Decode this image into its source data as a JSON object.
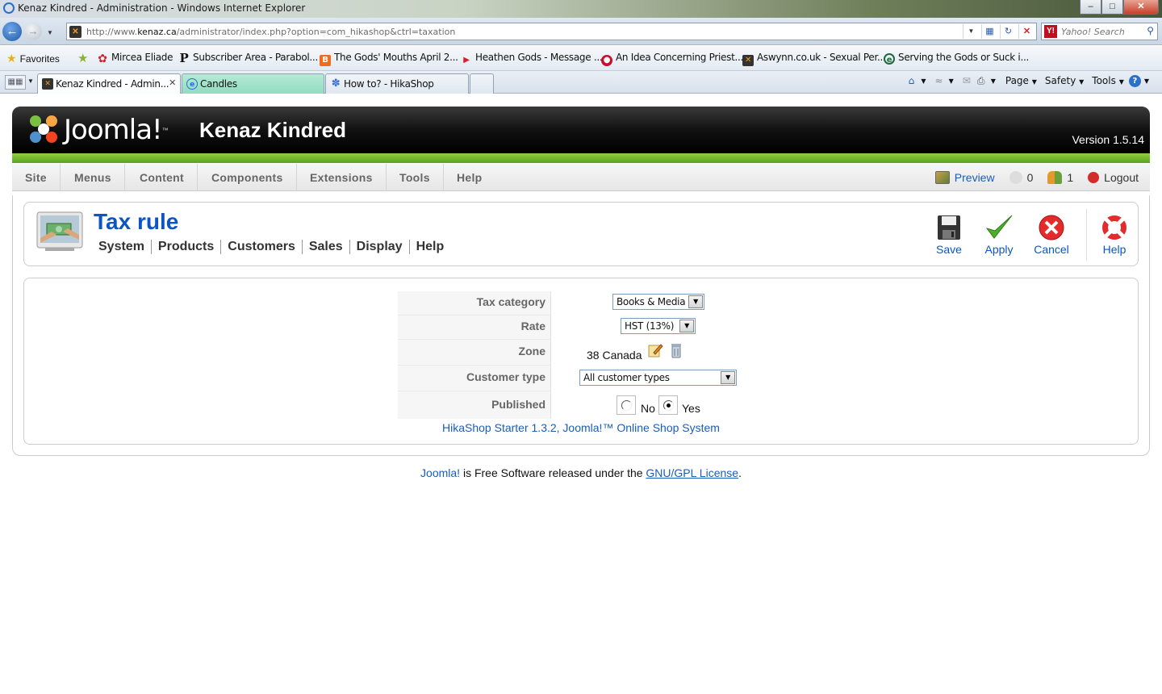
{
  "window": {
    "title": "Kenaz Kindred - Administration - Windows Internet Explorer",
    "url_prefix": "http://www.",
    "url_domain": "kenaz.ca",
    "url_rest": "/administrator/index.php?option=com_hikashop&ctrl=taxation",
    "search_placeholder": "Yahoo! Search"
  },
  "favorites_bar": {
    "favorites_label": "Favorites",
    "items": [
      {
        "label": "Mircea Eliade",
        "icon": "flower-icon",
        "color": "#d4202a"
      },
      {
        "label": "Subscriber Area - Parabol...",
        "icon": "p-icon",
        "color": "#111111"
      },
      {
        "label": "The Gods' Mouths April 2...",
        "icon": "blogger-icon",
        "color": "#f26b1d"
      },
      {
        "label": "Heathen Gods - Message ...",
        "icon": "arrow-icon",
        "color": "#d4202a"
      },
      {
        "label": "An Idea Concerning Priest...",
        "icon": "red-ball-icon",
        "color": "#c8102e"
      },
      {
        "label": "Aswynn.co.uk - Sexual Per...",
        "icon": "joomla-icon",
        "color": "#333333"
      },
      {
        "label": "Serving the Gods or Suck i...",
        "icon": "ie-icon",
        "color": "#1c6a3a"
      }
    ]
  },
  "tabs": [
    {
      "label": "Kenaz Kindred - Admin...",
      "active": true
    },
    {
      "label": "Candles",
      "active": false
    },
    {
      "label": "How to? - HikaShop",
      "active": false
    }
  ],
  "command_bar": {
    "page": "Page",
    "safety": "Safety",
    "tools": "Tools"
  },
  "admin": {
    "site_name": "Kenaz Kindred",
    "logo_text": "Joomla!",
    "version": "Version 1.5.14",
    "menu": [
      "Site",
      "Menus",
      "Content",
      "Components",
      "Extensions",
      "Tools",
      "Help"
    ],
    "status": {
      "preview": "Preview",
      "messages": "0",
      "users": "1",
      "logout": "Logout"
    }
  },
  "toolbar": {
    "title": "Tax rule",
    "submenu": [
      "System",
      "Products",
      "Customers",
      "Sales",
      "Display",
      "Help"
    ],
    "buttons": {
      "save": "Save",
      "apply": "Apply",
      "cancel": "Cancel",
      "help": "Help"
    }
  },
  "form": {
    "tax_category_label": "Tax category",
    "tax_category_value": "Books & Media",
    "rate_label": "Rate",
    "rate_value": "HST (13%)",
    "zone_label": "Zone",
    "zone_value": "38 Canada",
    "customer_type_label": "Customer type",
    "customer_type_value": "All customer types",
    "published_label": "Published",
    "published_no": "No",
    "published_yes": "Yes",
    "published_selected": "Yes"
  },
  "credit": "HikaShop Starter 1.3.2, Joomla!™ Online Shop System",
  "footer": {
    "joomla_link": "Joomla!",
    "middle_text": " is Free Software released under the ",
    "license_link": "GNU/GPL License",
    "end": "."
  }
}
